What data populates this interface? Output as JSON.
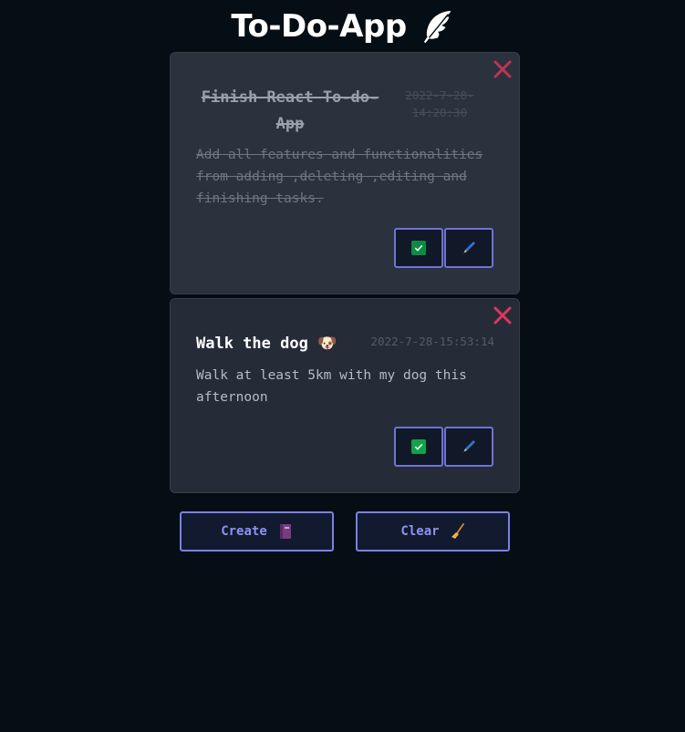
{
  "app": {
    "title": "To-Do-App",
    "title_icon": "feather-icon"
  },
  "todos": [
    {
      "title": "Finish React To-do-App",
      "date": "2022-7-28-14:20:30",
      "description": "Add all features and functionalities from adding ,deleting ,editing and finishing tasks.",
      "completed": true,
      "actions": [
        "complete",
        "edit"
      ]
    },
    {
      "title": "Walk the dog 🐶",
      "date": "2022-7-28-15:53:14",
      "description": "Walk at least 5km with my dog this afternoon",
      "completed": false,
      "actions": [
        "complete",
        "edit"
      ]
    }
  ],
  "buttons": {
    "create_label": "Create",
    "create_icon": "notebook-icon",
    "clear_label": "Clear",
    "clear_icon": "broom-icon"
  },
  "colors": {
    "background": "#050e14",
    "card_done": "#2a323e",
    "card_active": "#252c37",
    "accent": "#7b80e6",
    "close": "#e0355f",
    "check": "#11a24a"
  }
}
